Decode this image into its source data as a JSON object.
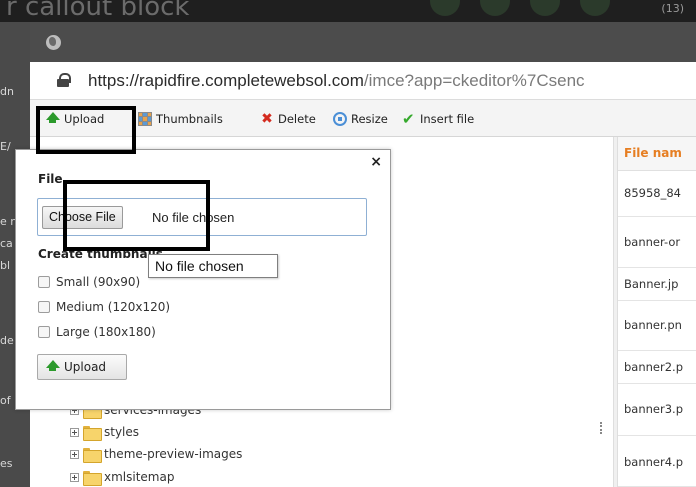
{
  "background": {
    "heading": "r callout block",
    "right_text": "(13)",
    "left_snippets": [
      "dn",
      "E/",
      "e n",
      "ca",
      "bl",
      "de",
      "of",
      "es"
    ]
  },
  "browser": {
    "url_host": "https://rapidfire.completewebsol.com",
    "url_path": "/imce?app=ckeditor%7Csenc"
  },
  "toolbar": {
    "upload": "Upload",
    "thumbnails": "Thumbnails",
    "delete": "Delete",
    "resize": "Resize",
    "insert_file": "Insert file"
  },
  "upload_form": {
    "file_label": "File",
    "choose_file": "Choose File",
    "no_file": "No file chosen",
    "thumbs_label": "Create thumbnails",
    "options": [
      "Small (90x90)",
      "Medium (120x120)",
      "Large (180x180)"
    ],
    "upload_button": "Upload",
    "close": "×"
  },
  "tooltip": "No file chosen",
  "folders": [
    "services-images",
    "styles",
    "theme-preview-images",
    "xmlsitemap"
  ],
  "files": {
    "header": "File nam",
    "rows": [
      "85958_84",
      "banner-or",
      "Banner.jp",
      "banner.pn",
      "banner2.p",
      "banner3.p",
      "banner4.p"
    ]
  },
  "colors": {
    "file_header": "#e67e22",
    "annotation": "#000000"
  }
}
